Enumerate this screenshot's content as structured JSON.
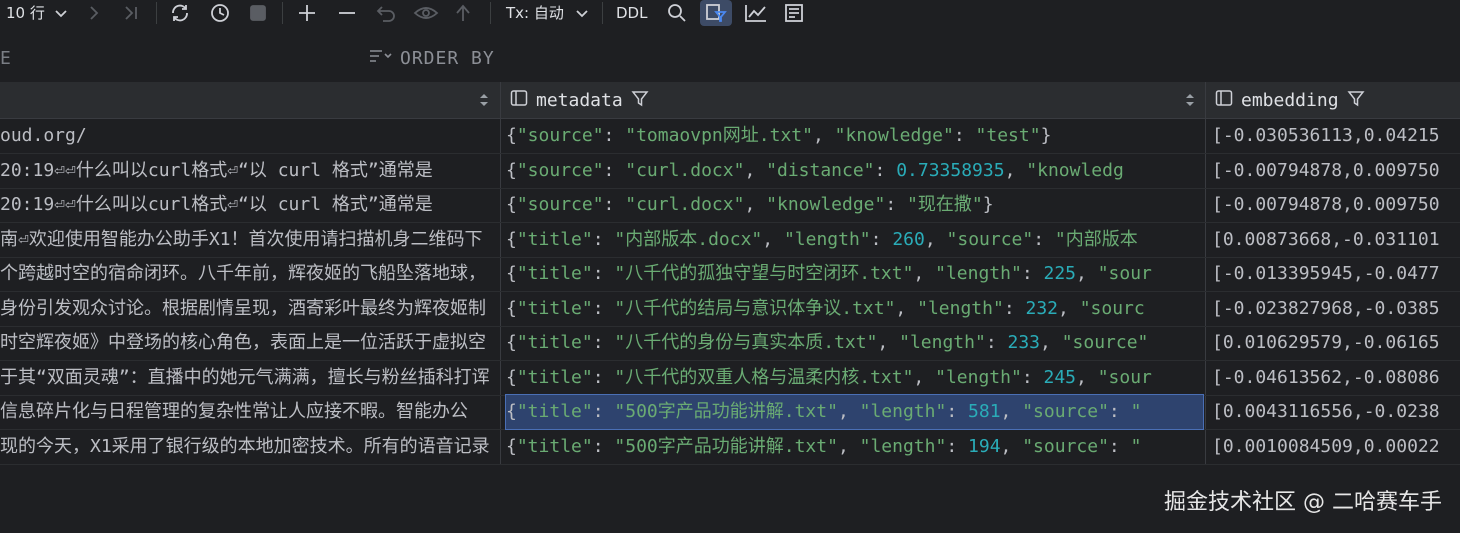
{
  "toolbar": {
    "rows_label": "10 行",
    "tx_label": "Tx: 自动",
    "ddl_label": "DDL",
    "icons": [
      "chevron-down-icon",
      "next-page-icon",
      "last-page-icon",
      "refresh-icon",
      "history-icon",
      "stop-icon",
      "add-row-icon",
      "remove-row-icon",
      "revert-icon",
      "preview-icon",
      "submit-icon",
      "chevron-down-icon",
      "search-icon",
      "filter-rows-icon",
      "chart-icon",
      "view-mode-icon"
    ]
  },
  "filterbar": {
    "where_partial": "E",
    "order_by": "ORDER BY"
  },
  "columns": {
    "col1_sort": "⇕",
    "metadata": "metadata",
    "embedding": "embedding"
  },
  "rows": [
    {
      "c1": "oud.org/",
      "meta": [
        [
          "p",
          "{"
        ],
        [
          "k",
          "\"source\""
        ],
        [
          "p",
          ": "
        ],
        [
          "k",
          "\"tomaovpn网址.txt\""
        ],
        [
          "p",
          ", "
        ],
        [
          "k",
          "\"knowledge\""
        ],
        [
          "p",
          ": "
        ],
        [
          "k",
          "\"test\""
        ],
        [
          "p",
          "}"
        ]
      ],
      "emb": "[-0.030536113,0.04215"
    },
    {
      "c1": "    20:19⏎⏎什么叫以curl格式⏎“以 curl 格式”通常是",
      "meta": [
        [
          "p",
          "{"
        ],
        [
          "k",
          "\"source\""
        ],
        [
          "p",
          ": "
        ],
        [
          "k",
          "\"curl.docx\""
        ],
        [
          "p",
          ", "
        ],
        [
          "k",
          "\"distance\""
        ],
        [
          "p",
          ": "
        ],
        [
          "n",
          "0.73358935"
        ],
        [
          "p",
          ", "
        ],
        [
          "k",
          "\"knowledg"
        ]
      ],
      "emb": "[-0.00794878,0.009750"
    },
    {
      "c1": "    20:19⏎⏎什么叫以curl格式⏎“以 curl 格式”通常是",
      "meta": [
        [
          "p",
          "{"
        ],
        [
          "k",
          "\"source\""
        ],
        [
          "p",
          ": "
        ],
        [
          "k",
          "\"curl.docx\""
        ],
        [
          "p",
          ", "
        ],
        [
          "k",
          "\"knowledge\""
        ],
        [
          "p",
          ": "
        ],
        [
          "k",
          "\"现在撒\""
        ],
        [
          "p",
          "}"
        ]
      ],
      "emb": "[-0.00794878,0.009750"
    },
    {
      "c1": "南⏎欢迎使用智能办公助手X1！首次使用请扫描机身二维码下",
      "meta": [
        [
          "p",
          "{"
        ],
        [
          "k",
          "\"title\""
        ],
        [
          "p",
          ": "
        ],
        [
          "k",
          "\"内部版本.docx\""
        ],
        [
          "p",
          ", "
        ],
        [
          "k",
          "\"length\""
        ],
        [
          "p",
          ": "
        ],
        [
          "n",
          "260"
        ],
        [
          "p",
          ", "
        ],
        [
          "k",
          "\"source\""
        ],
        [
          "p",
          ": "
        ],
        [
          "k",
          "\"内部版本"
        ]
      ],
      "emb": "[0.00873668,-0.031101"
    },
    {
      "c1": "个跨越时空的宿命闭环。八千年前，辉夜姬的飞船坠落地球，",
      "meta": [
        [
          "p",
          "{"
        ],
        [
          "k",
          "\"title\""
        ],
        [
          "p",
          ": "
        ],
        [
          "k",
          "\"八千代的孤独守望与时空闭环.txt\""
        ],
        [
          "p",
          ", "
        ],
        [
          "k",
          "\"length\""
        ],
        [
          "p",
          ": "
        ],
        [
          "n",
          "225"
        ],
        [
          "p",
          ", "
        ],
        [
          "k",
          "\"sour"
        ]
      ],
      "emb": "[-0.013395945,-0.0477"
    },
    {
      "c1": "身份引发观众讨论。根据剧情呈现，酒寄彩叶最终为辉夜姬制",
      "meta": [
        [
          "p",
          "{"
        ],
        [
          "k",
          "\"title\""
        ],
        [
          "p",
          ": "
        ],
        [
          "k",
          "\"八千代的结局与意识体争议.txt\""
        ],
        [
          "p",
          ", "
        ],
        [
          "k",
          "\"length\""
        ],
        [
          "p",
          ": "
        ],
        [
          "n",
          "232"
        ],
        [
          "p",
          ", "
        ],
        [
          "k",
          "\"sourc"
        ]
      ],
      "emb": "[-0.023827968,-0.0385"
    },
    {
      "c1": "时空辉夜姬》中登场的核心角色，表面上是一位活跃于虚拟空",
      "meta": [
        [
          "p",
          "{"
        ],
        [
          "k",
          "\"title\""
        ],
        [
          "p",
          ": "
        ],
        [
          "k",
          "\"八千代的身份与真实本质.txt\""
        ],
        [
          "p",
          ", "
        ],
        [
          "k",
          "\"length\""
        ],
        [
          "p",
          ": "
        ],
        [
          "n",
          "233"
        ],
        [
          "p",
          ", "
        ],
        [
          "k",
          "\"source\""
        ]
      ],
      "emb": "[0.010629579,-0.06165"
    },
    {
      "c1": "于其“双面灵魂”：直播中的她元气满满，擅长与粉丝插科打诨",
      "meta": [
        [
          "p",
          "{"
        ],
        [
          "k",
          "\"title\""
        ],
        [
          "p",
          ": "
        ],
        [
          "k",
          "\"八千代的双重人格与温柔内核.txt\""
        ],
        [
          "p",
          ", "
        ],
        [
          "k",
          "\"length\""
        ],
        [
          "p",
          ": "
        ],
        [
          "n",
          "245"
        ],
        [
          "p",
          ", "
        ],
        [
          "k",
          "\"sour"
        ]
      ],
      "emb": "[-0.04613562,-0.08086"
    },
    {
      "c1": " 信息碎片化与日程管理的复杂性常让人应接不暇。智能办公",
      "meta": [
        [
          "p",
          "{"
        ],
        [
          "k",
          "\"title\""
        ],
        [
          "p",
          ": "
        ],
        [
          "k",
          "\"500字产品功能讲解.txt\""
        ],
        [
          "p",
          ", "
        ],
        [
          "k",
          "\"length\""
        ],
        [
          "p",
          ": "
        ],
        [
          "n",
          "581"
        ],
        [
          "p",
          ", "
        ],
        [
          "k",
          "\"source\""
        ],
        [
          "p",
          ": "
        ],
        [
          "k",
          "\""
        ]
      ],
      "emb": "[0.0043116556,-0.0238",
      "selected": true
    },
    {
      "c1": "现的今天，X1采用了银行级的本地加密技术。所有的语音记录",
      "meta": [
        [
          "p",
          "{"
        ],
        [
          "k",
          "\"title\""
        ],
        [
          "p",
          ": "
        ],
        [
          "k",
          "\"500字产品功能讲解.txt\""
        ],
        [
          "p",
          ", "
        ],
        [
          "k",
          "\"length\""
        ],
        [
          "p",
          ": "
        ],
        [
          "n",
          "194"
        ],
        [
          "p",
          ", "
        ],
        [
          "k",
          "\"source\""
        ],
        [
          "p",
          ": "
        ],
        [
          "k",
          "\""
        ]
      ],
      "emb": "[0.0010084509,0.00022"
    }
  ],
  "watermark": "掘金技术社区 @ 二哈赛车手"
}
